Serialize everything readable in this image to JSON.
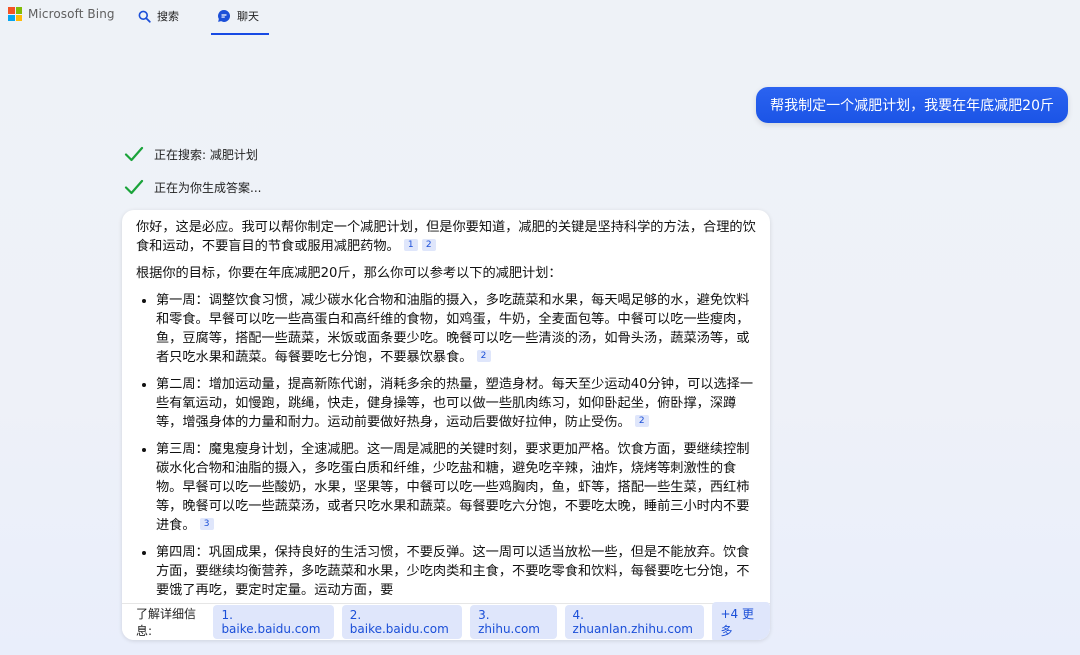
{
  "brand": {
    "name": "Microsoft Bing",
    "colors": [
      "#f35325",
      "#81bc06",
      "#05a6f0",
      "#ffba08"
    ]
  },
  "nav": {
    "search": {
      "label": "搜索",
      "icon": "search-icon"
    },
    "chat": {
      "label": "聊天",
      "icon": "chat-icon"
    }
  },
  "user_message": "帮我制定一个减肥计划，我要在年底减肥20斤",
  "status": [
    {
      "text": "正在搜索: 减肥计划"
    },
    {
      "text": "正在为你生成答案..."
    }
  ],
  "answer": {
    "intro": "你好，这是必应。我可以帮你制定一个减肥计划，但是你要知道，减肥的关键是坚持科学的方法，合理的饮食和运动，不要盲目的节食或服用减肥药物。",
    "intro_cites": [
      "1",
      "2"
    ],
    "lead": "根据你的目标，你要在年底减肥20斤，那么你可以参考以下的减肥计划：",
    "items": [
      {
        "text": "第一周：调整饮食习惯，减少碳水化合物和油脂的摄入，多吃蔬菜和水果，每天喝足够的水，避免饮料和零食。早餐可以吃一些高蛋白和高纤维的食物，如鸡蛋，牛奶，全麦面包等。中餐可以吃一些瘦肉，鱼，豆腐等，搭配一些蔬菜，米饭或面条要少吃。晚餐可以吃一些清淡的汤，如骨头汤，蔬菜汤等，或者只吃水果和蔬菜。每餐要吃七分饱，不要暴饮暴食。",
        "cite": "2"
      },
      {
        "text": "第二周：增加运动量，提高新陈代谢，消耗多余的热量，塑造身材。每天至少运动40分钟，可以选择一些有氧运动，如慢跑，跳绳，快走，健身操等，也可以做一些肌肉练习，如仰卧起坐，俯卧撑，深蹲等，增强身体的力量和耐力。运动前要做好热身，运动后要做好拉伸，防止受伤。",
        "cite": "2"
      },
      {
        "text": "第三周：魔鬼瘦身计划，全速减肥。这一周是减肥的关键时刻，要求更加严格。饮食方面，要继续控制碳水化合物和油脂的摄入，多吃蛋白质和纤维，少吃盐和糖，避免吃辛辣，油炸，烧烤等刺激性的食物。早餐可以吃一些酸奶，水果，坚果等，中餐可以吃一些鸡胸肉，鱼，虾等，搭配一些生菜，西红柿等，晚餐可以吃一些蔬菜汤，或者只吃水果和蔬菜。每餐要吃六分饱，不要吃太晚，睡前三小时内不要进食。",
        "cite": "3"
      },
      {
        "text": "第四周：巩固成果，保持良好的生活习惯，不要反弹。这一周可以适当放松一些，但是不能放弃。饮食方面，要继续均衡营养，多吃蔬菜和水果，少吃肉类和主食，不要吃零食和饮料，每餐要吃七分饱，不要饿了再吃，要定时定量。运动方面，要",
        "cite": ""
      }
    ]
  },
  "sources": {
    "label": "了解详细信息:",
    "links": [
      "1. baike.baidu.com",
      "2. baike.baidu.com",
      "3. zhihu.com",
      "4. zhuanlan.zhihu.com",
      "+4 更多"
    ]
  },
  "colors": {
    "accent": "#174ae4",
    "check": "#1aa33a"
  }
}
